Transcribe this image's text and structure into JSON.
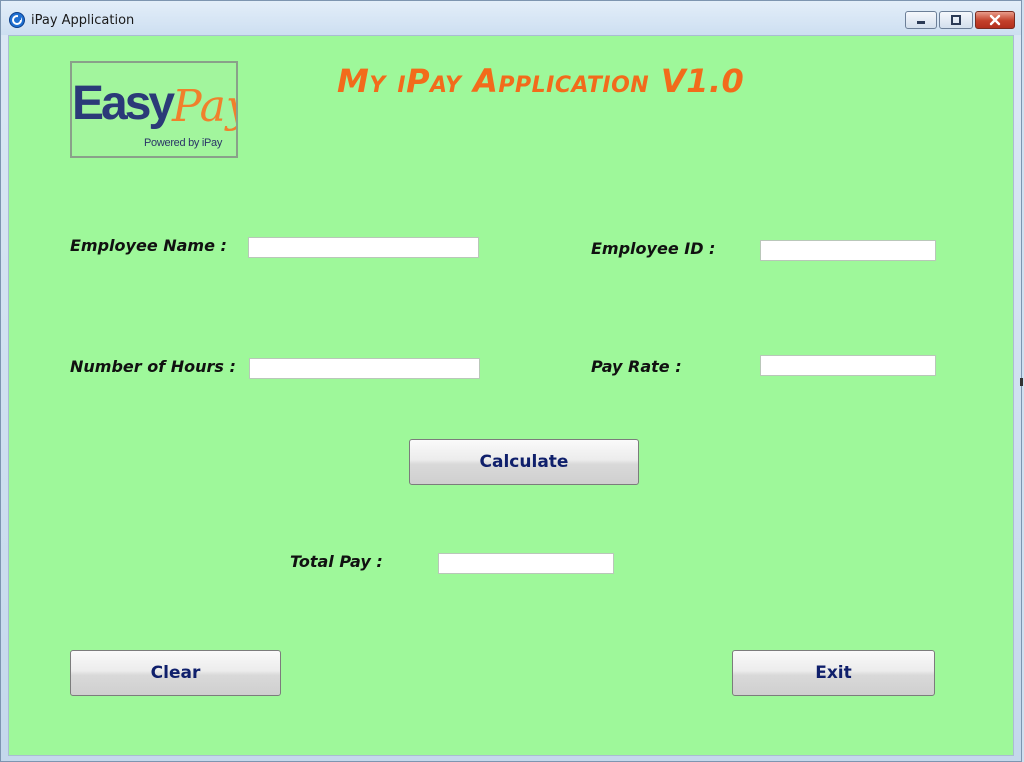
{
  "window": {
    "title": "iPay Application",
    "controls": {
      "minimize_icon": "minimize-icon",
      "maximize_icon": "maximize-icon",
      "close_icon": "close-icon"
    }
  },
  "logo": {
    "word_easy": "Easy",
    "word_pay": "Pay",
    "tagline": "Powered by iPay",
    "colors": {
      "easy": "#2b3a78",
      "pay": "#f0802c"
    }
  },
  "header": {
    "title": "My iPay Application V1.0",
    "color": "#f26b1b"
  },
  "form": {
    "employee_name": {
      "label": "Employee Name :",
      "value": ""
    },
    "employee_id": {
      "label": "Employee ID :",
      "value": ""
    },
    "hours": {
      "label": "Number of Hours :",
      "value": ""
    },
    "pay_rate": {
      "label": "Pay Rate :",
      "value": ""
    },
    "total_pay": {
      "label": "Total Pay :",
      "value": ""
    }
  },
  "buttons": {
    "calculate": "Calculate",
    "clear": "Clear",
    "exit": "Exit"
  },
  "theme": {
    "background": "#9ef89a",
    "button_text": "#0f1f6b"
  }
}
